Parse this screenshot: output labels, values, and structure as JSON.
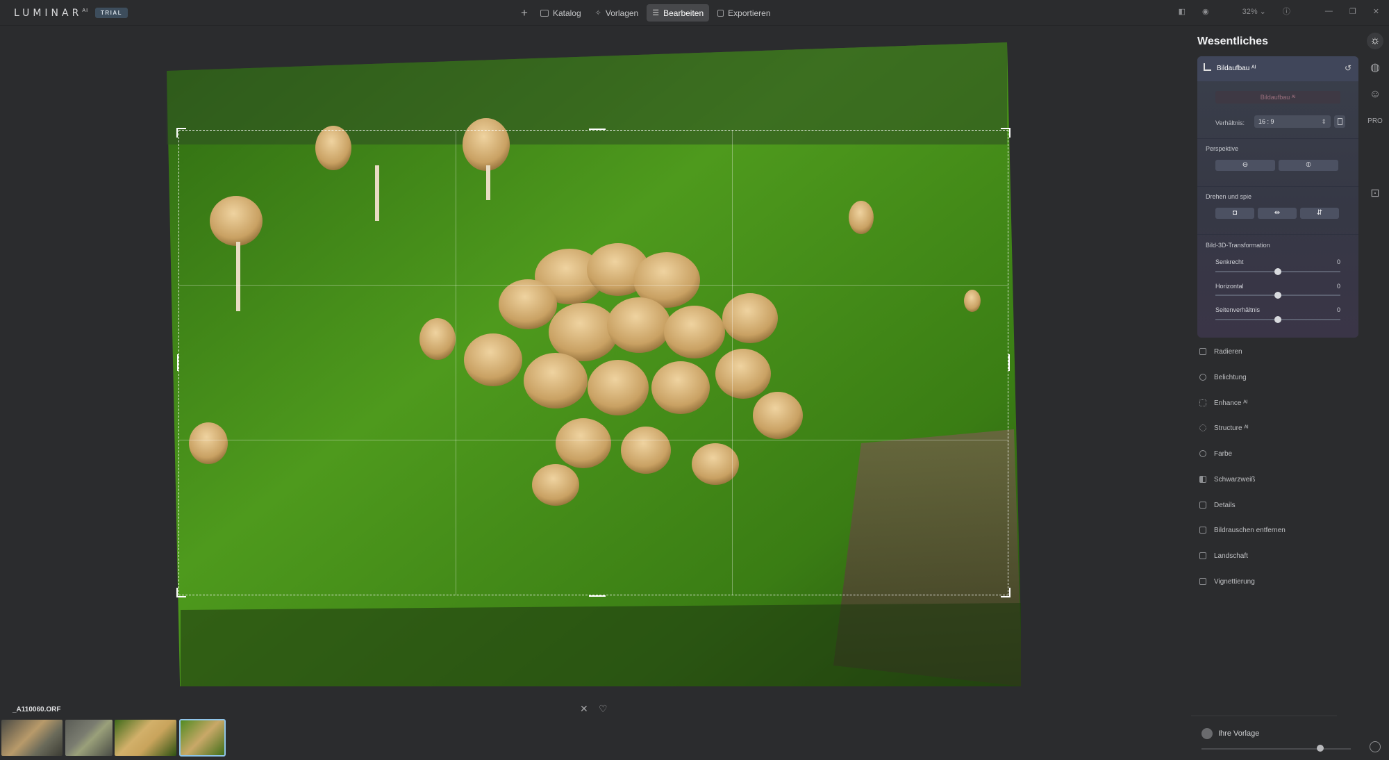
{
  "app": {
    "logo": "LUMINAR",
    "logo_sup": "AI",
    "badge": "TRIAL"
  },
  "topnav": {
    "items": [
      {
        "label": "Katalog",
        "icon": "folder-icon",
        "active": false
      },
      {
        "label": "Vorlagen",
        "icon": "sparkle-icon",
        "active": false
      },
      {
        "label": "Bearbeiten",
        "icon": "sliders-icon",
        "active": true
      },
      {
        "label": "Exportieren",
        "icon": "export-icon",
        "active": false
      }
    ],
    "zoom": "32%"
  },
  "panel": {
    "title": "Wesentliches",
    "card": {
      "title": "Bildaufbau ᴬᴵ",
      "ghost_button": "Bildaufbau ᴬᴵ",
      "ratio_label": "Verhältnis:",
      "ratio_value": "16 : 9",
      "perspective_label": "Perspektive",
      "rotate_label": "Drehen und spie",
      "transform_label": "Bild-3D-Transformation",
      "sliders": [
        {
          "label": "Senkrecht",
          "value": "0",
          "level": 0.5
        },
        {
          "label": "Horizontal",
          "value": "0",
          "level": 0.5
        },
        {
          "label": "Seitenverhältnis",
          "value": "0",
          "level": 0.5
        }
      ]
    },
    "tools": [
      "Radieren",
      "Belichtung",
      "Enhance ᴬᴵ",
      "Structure ᴬᴵ",
      "Farbe",
      "Schwarzweiß",
      "Details",
      "Bildrauschen entfernen",
      "Landschaft",
      "Vignettierung"
    ],
    "preset": "Ihre Vorlage"
  },
  "rail": {
    "pro_label": "PRO"
  },
  "filmstrip": {
    "filename": "_A110060.ORF"
  }
}
